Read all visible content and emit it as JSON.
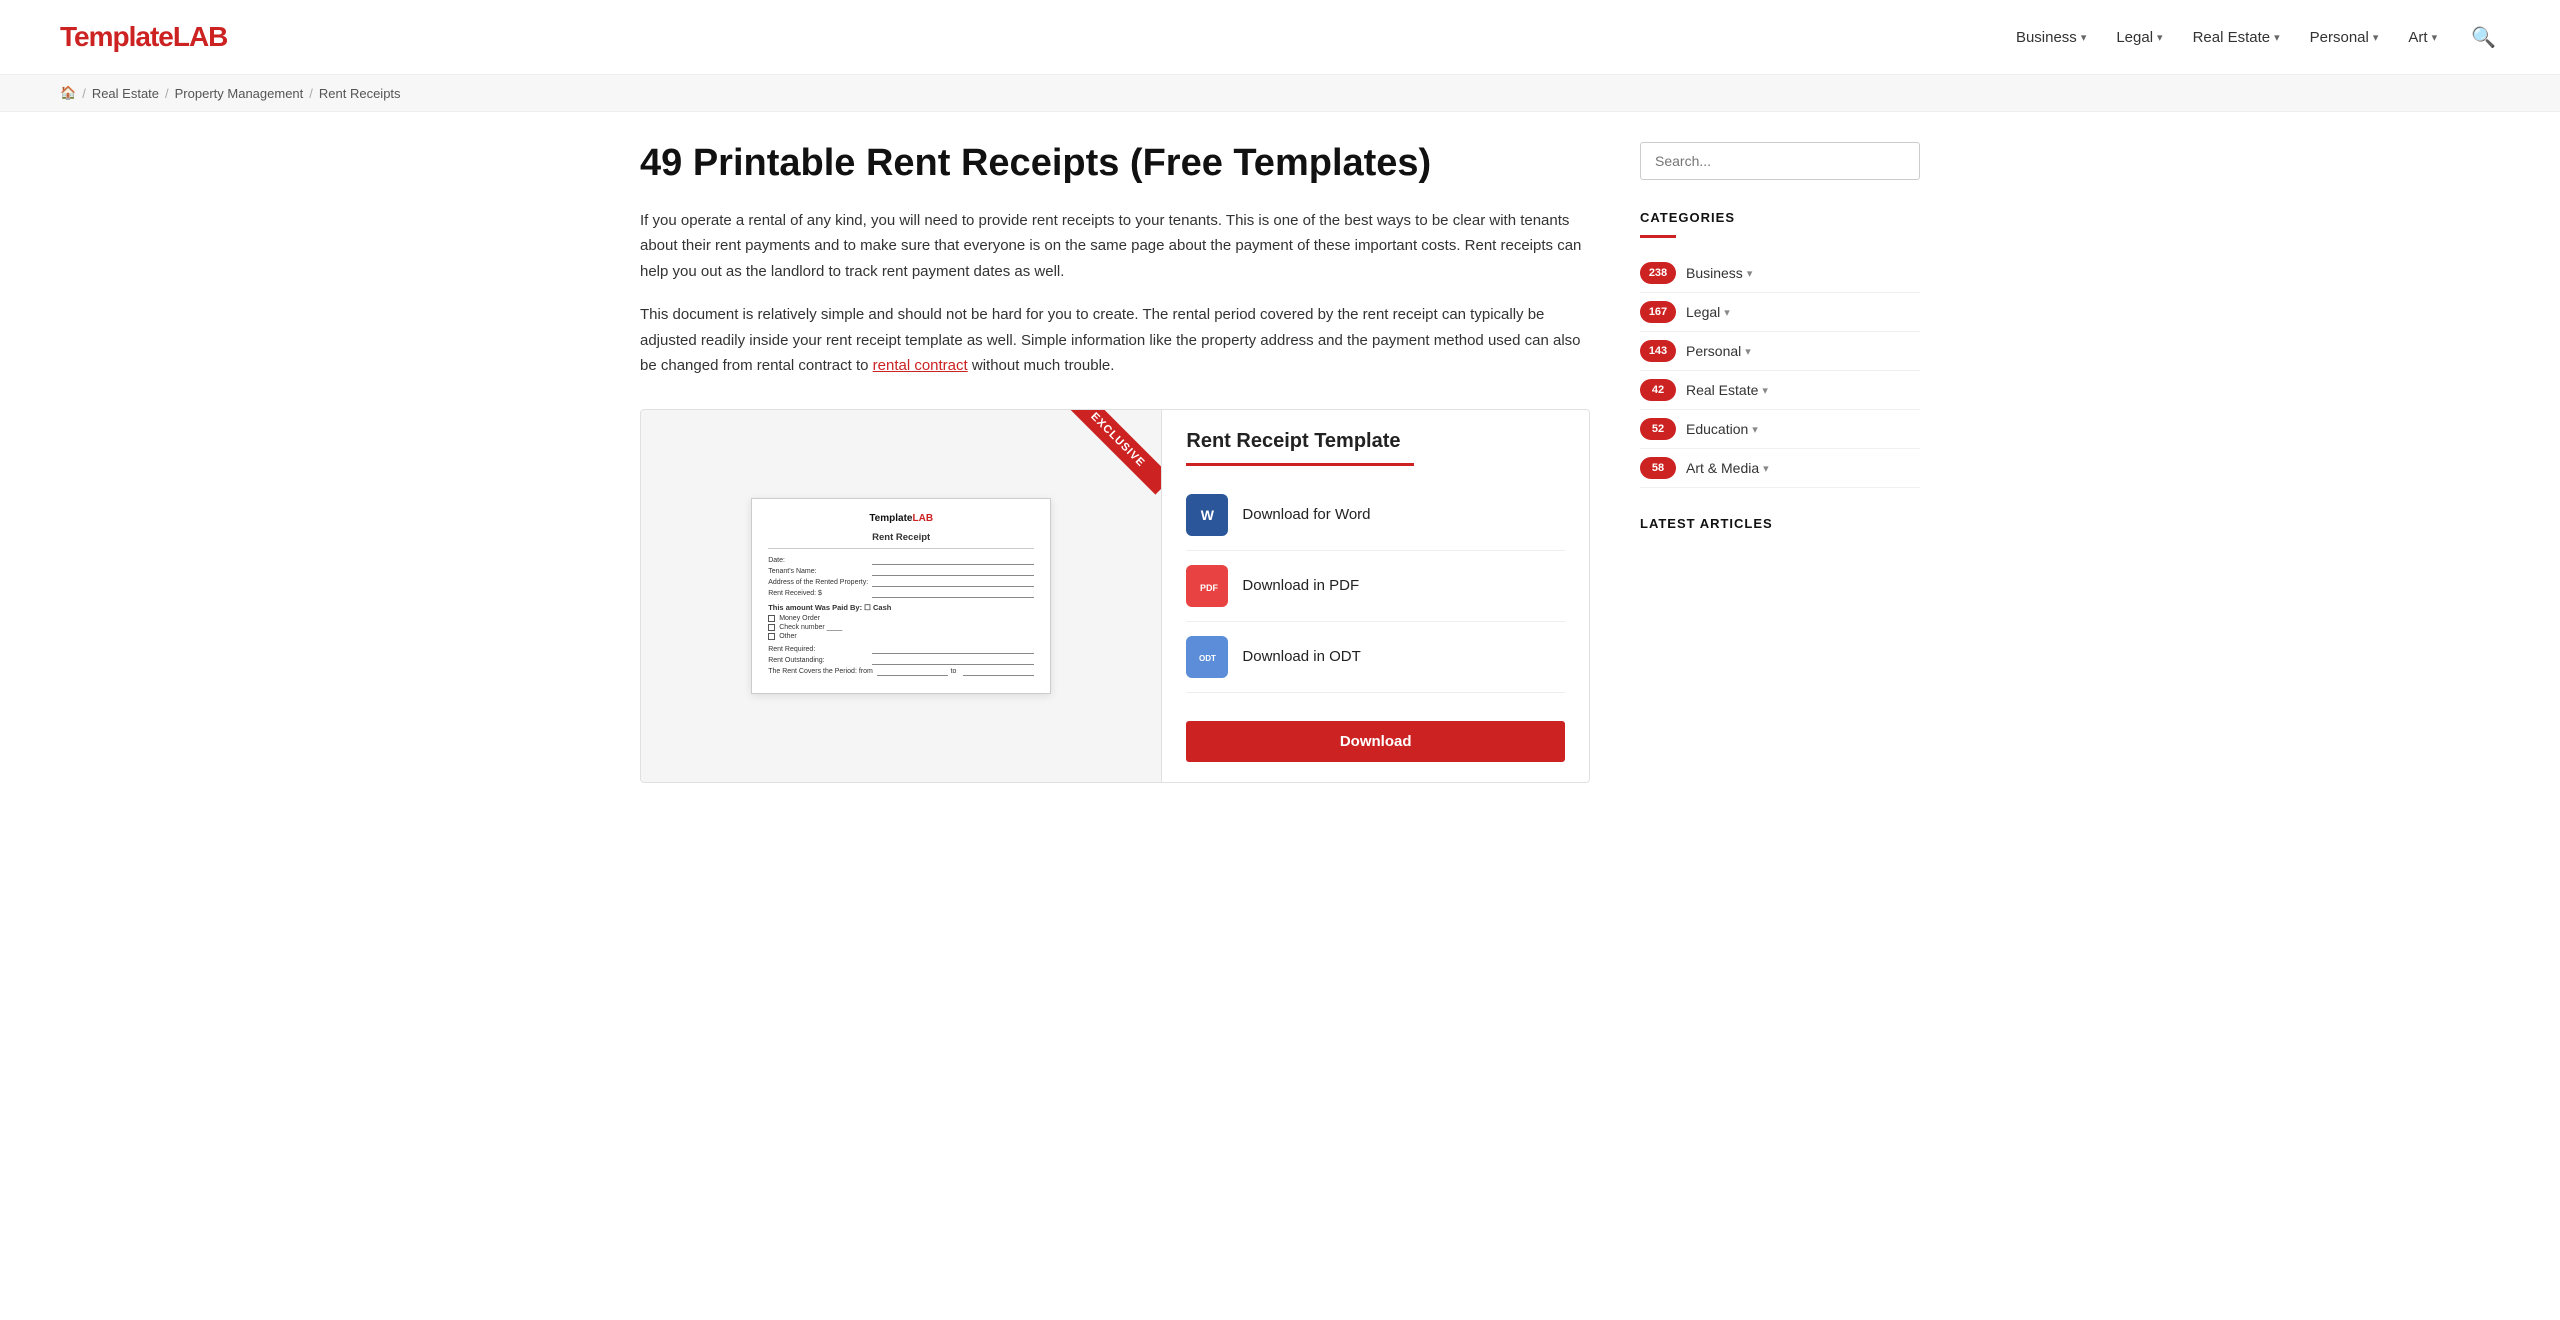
{
  "logo": {
    "template_text": "Template",
    "lab_text": "LAB"
  },
  "nav": {
    "items": [
      {
        "label": "Business",
        "has_dropdown": true
      },
      {
        "label": "Legal",
        "has_dropdown": true
      },
      {
        "label": "Real Estate",
        "has_dropdown": true
      },
      {
        "label": "Personal",
        "has_dropdown": true
      },
      {
        "label": "Art",
        "has_dropdown": true
      }
    ]
  },
  "breadcrumb": {
    "home_icon": "🏠",
    "items": [
      {
        "label": "Real Estate",
        "link": true
      },
      {
        "label": "Property Management",
        "link": true
      },
      {
        "label": "Rent Receipts",
        "link": false
      }
    ]
  },
  "page": {
    "title": "49 Printable Rent Receipts (Free Templates)",
    "intro_1": "If you operate a rental of any kind, you will need to provide rent receipts to your tenants. This is one of the best ways to be clear with tenants about their rent payments and to make sure that everyone is on the same page about the payment of these important costs. Rent receipts can help you out as the landlord to track rent payment dates as well.",
    "intro_2_pre": "This document is relatively simple and should not be hard for you to create. The rental period covered by the rent receipt can typically be adjusted readily inside your rent receipt template as well. Simple information like the property address and the payment method used can also be changed from rental contract to ",
    "intro_2_link": "rental contract",
    "intro_2_post": " without much trouble."
  },
  "template_card": {
    "title": "Rent Receipt Template",
    "exclusive_label": "EXCLUSIVE",
    "doc": {
      "brand": "TemplateLAB",
      "title": "Rent Receipt",
      "fields": [
        "Date:",
        "Tenant's Name:",
        "Address of the Rented Property:",
        "Rent Received: $",
        "This amount Was Paid By:"
      ],
      "checkboxes": [
        "Money Order",
        "Check number",
        "Other"
      ],
      "fields2": [
        "Rent Required:",
        "Rent Outstanding:",
        "The Rent Covers the Period: from ___ to ___"
      ]
    },
    "download_options": [
      {
        "label": "Download for Word",
        "icon_type": "word",
        "icon_text": "W"
      },
      {
        "label": "Download in PDF",
        "icon_type": "pdf",
        "icon_text": "PDF"
      },
      {
        "label": "Download in ODT",
        "icon_type": "odt",
        "icon_text": "ODT"
      }
    ],
    "download_button_label": "Download"
  },
  "sidebar": {
    "search_placeholder": "Search...",
    "categories_title": "CATEGORIES",
    "categories": [
      {
        "count": "238",
        "label": "Business",
        "has_dropdown": true
      },
      {
        "count": "167",
        "label": "Legal",
        "has_dropdown": true
      },
      {
        "count": "143",
        "label": "Personal",
        "has_dropdown": true
      },
      {
        "count": "42",
        "label": "Real Estate",
        "has_dropdown": true
      },
      {
        "count": "52",
        "label": "Education",
        "has_dropdown": true
      },
      {
        "count": "58",
        "label": "Art & Media",
        "has_dropdown": true
      }
    ],
    "latest_articles_title": "LATEST ARTICLES"
  }
}
